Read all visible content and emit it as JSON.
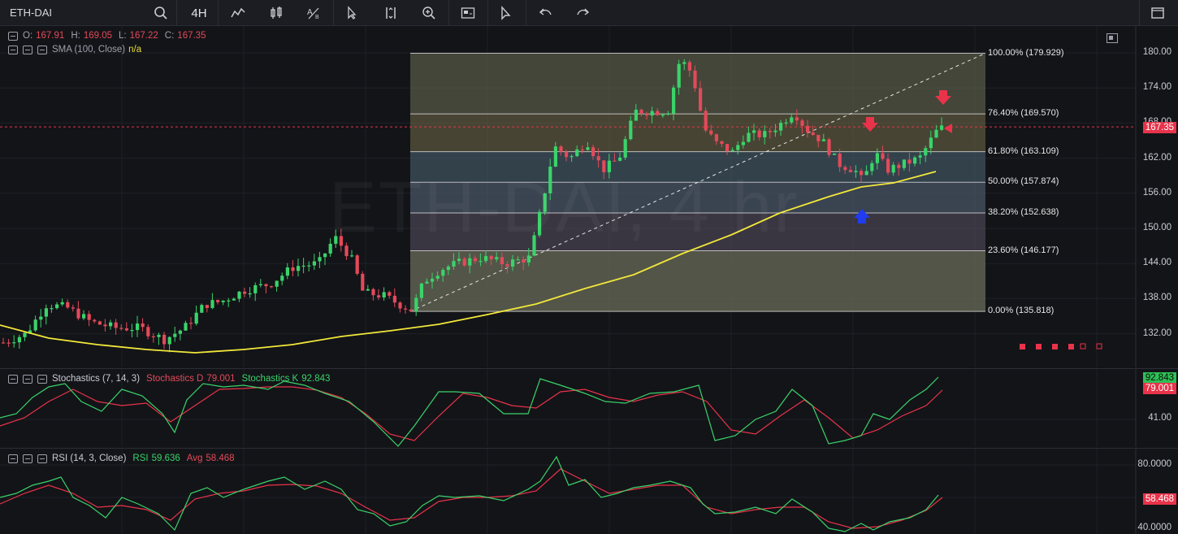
{
  "toolbar": {
    "symbol": "ETH-DAI",
    "interval": "4H",
    "icons": [
      "search-icon",
      "line-icon",
      "candles-icon",
      "text-tool-icon",
      "cursor-icon",
      "vertical-arrows-icon",
      "zoom-in-icon",
      "screenshot-icon",
      "pointer-icon",
      "undo-icon",
      "redo-icon",
      "fullscreen-icon"
    ]
  },
  "main": {
    "legend": {
      "ohlc_labels": [
        "O:",
        "H:",
        "L:",
        "C:"
      ],
      "ohlc_values": [
        "167.91",
        "169.05",
        "167.22",
        "167.35"
      ],
      "sma_label": "SMA (100, Close)",
      "sma_value": "n/a"
    },
    "watermark": "ETH-DAI, 4 hr",
    "price_axis": [
      "180.00",
      "174.00",
      "168.00",
      "162.00",
      "156.00",
      "150.00",
      "144.00",
      "138.00",
      "132.00"
    ],
    "current_price": "167.35",
    "fib_levels": [
      {
        "label": "100.00% (179.929)",
        "price": 179.929
      },
      {
        "label": "76.40% (169.570)",
        "price": 169.57
      },
      {
        "label": "61.80% (163.109)",
        "price": 163.109
      },
      {
        "label": "50.00% (157.874)",
        "price": 157.874
      },
      {
        "label": "38.20% (152.638)",
        "price": 152.638
      },
      {
        "label": "23.60% (146.177)",
        "price": 146.177
      },
      {
        "label": "0.00% (135.818)",
        "price": 135.818
      }
    ],
    "colors": {
      "up": "#3ad36a",
      "down": "#e24a5a",
      "sma": "#f2e83a",
      "arrow_down": "#e8334a",
      "arrow_up": "#1f3cf0"
    }
  },
  "stochastics": {
    "title": "Stochastics (7, 14, 3)",
    "d_label": "Stochastics D",
    "d_value": "79.001",
    "k_label": "Stochastics K",
    "k_value": "92.843",
    "axis": [
      "41.00"
    ],
    "tag_k": "92.843",
    "tag_d": "79.001"
  },
  "rsi": {
    "title": "RSI (14, 3, Close)",
    "rsi_label": "RSI",
    "rsi_value": "59.636",
    "avg_label": "Avg",
    "avg_value": "58.468",
    "axis": [
      "80.0000",
      "40.0000"
    ],
    "tag": "58.468"
  }
}
